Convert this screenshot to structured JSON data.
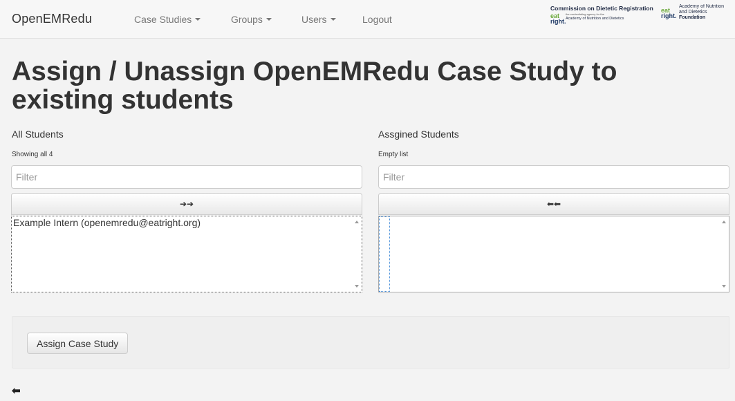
{
  "navbar": {
    "brand": "OpenEMRedu",
    "menu": [
      {
        "label": "Case Studies",
        "dropdown": true
      },
      {
        "label": "Groups",
        "dropdown": true
      },
      {
        "label": "Users",
        "dropdown": true
      },
      {
        "label": "Logout",
        "dropdown": false
      }
    ],
    "logos": {
      "cdr_title": "Commission on Dietetic Registration",
      "cdr_tagline": "the credentialing agency for the",
      "cdr_subtitle": "Academy of Nutrition and Dietetics",
      "eat_mark_top": "eat",
      "eat_mark_bottom": "right.",
      "foundation_line1": "Academy of Nutrition",
      "foundation_line2": "and Dietetics",
      "foundation_line3": "Foundation"
    }
  },
  "page": {
    "title": "Assign / Unassign OpenEMRedu Case Study to existing students"
  },
  "all_students": {
    "label": "All Students",
    "info": "Showing all 4",
    "filter_placeholder": "Filter",
    "move_all_label": "➔➔",
    "options": [
      "Example Intern (openemredu@eatright.org)"
    ]
  },
  "assigned_students": {
    "label": "Assgined Students",
    "info": "Empty list",
    "filter_placeholder": "Filter",
    "remove_all_label": "⬅⬅",
    "options": []
  },
  "actions": {
    "assign_label": "Assign Case Study",
    "back_icon": "⬅"
  },
  "colors": {
    "navbar_bg": "#f7f7f7",
    "page_bg": "#f3f3f3",
    "eat_green": "#6aa83a",
    "right_navy": "#1f3a66"
  }
}
